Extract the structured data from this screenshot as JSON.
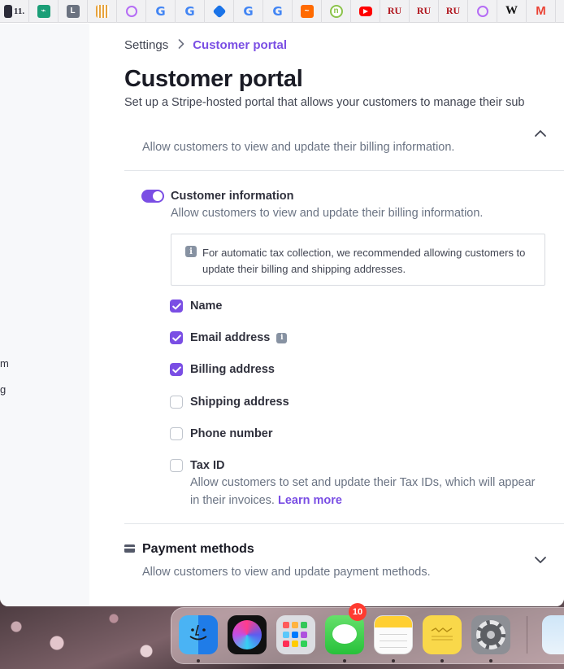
{
  "bookmarks": [
    {
      "icon": "bookmark-dark-icon",
      "label": "11."
    },
    {
      "icon": "bookmark-green-icon",
      "label": ""
    },
    {
      "icon": "bookmark-l-icon",
      "label": "L"
    },
    {
      "icon": "bookmark-grid-icon",
      "label": ""
    },
    {
      "icon": "bookmark-ring-icon",
      "label": ""
    },
    {
      "icon": "google-icon",
      "label": "G"
    },
    {
      "icon": "google-icon",
      "label": "G"
    },
    {
      "icon": "bookmark-blue-diamond-icon",
      "label": ""
    },
    {
      "icon": "google-icon",
      "label": "G"
    },
    {
      "icon": "google-icon",
      "label": "G"
    },
    {
      "icon": "bookmark-orange-icon",
      "label": ""
    },
    {
      "icon": "bookmark-n-icon",
      "label": "n"
    },
    {
      "icon": "youtube-icon",
      "label": ""
    },
    {
      "icon": "ru-icon",
      "label": "RU"
    },
    {
      "icon": "ru-icon",
      "label": "RU"
    },
    {
      "icon": "ru-icon",
      "label": "RU"
    },
    {
      "icon": "bookmark-ring-icon",
      "label": ""
    },
    {
      "icon": "wikipedia-icon",
      "label": "W"
    },
    {
      "icon": "gmail-icon",
      "label": "M"
    }
  ],
  "sidebar": {
    "fragments": [
      "m",
      "g"
    ]
  },
  "breadcrumb": {
    "settings": "Settings",
    "separator": ">",
    "current": "Customer portal"
  },
  "page": {
    "title": "Customer portal",
    "description": "Set up a Stripe-hosted portal that allows your customers to manage their sub"
  },
  "billing_section": {
    "description": "Allow customers to view and update their billing information.",
    "customer_information": {
      "enabled": true,
      "title": "Customer information",
      "description": "Allow customers to view and update their billing information."
    },
    "info_note": "For automatic tax collection, we recommended allowing customers to update their billing and shipping addresses.",
    "options": [
      {
        "label": "Name",
        "checked": true
      },
      {
        "label": "Email address",
        "checked": true
      },
      {
        "label": "Billing address",
        "checked": true
      },
      {
        "label": "Shipping address",
        "checked": false
      },
      {
        "label": "Phone number",
        "checked": false
      },
      {
        "label": "Tax ID",
        "checked": false
      }
    ],
    "tax_id_description": "Allow customers to set and update their Tax IDs, which will appear in their invoices.",
    "learn_more": "Learn more"
  },
  "payment_methods": {
    "title": "Payment methods",
    "description": "Allow customers to view and update payment methods."
  },
  "dock": {
    "apps": [
      "Finder",
      "Siri",
      "Launchpad",
      "Messages",
      "Notes",
      "Stickies",
      "System Preferences",
      "Preview"
    ],
    "messages_badge": "10"
  },
  "colors": {
    "accent": "#7a4ee4",
    "text_primary": "#1a1b25",
    "text_secondary": "#6a7383"
  }
}
